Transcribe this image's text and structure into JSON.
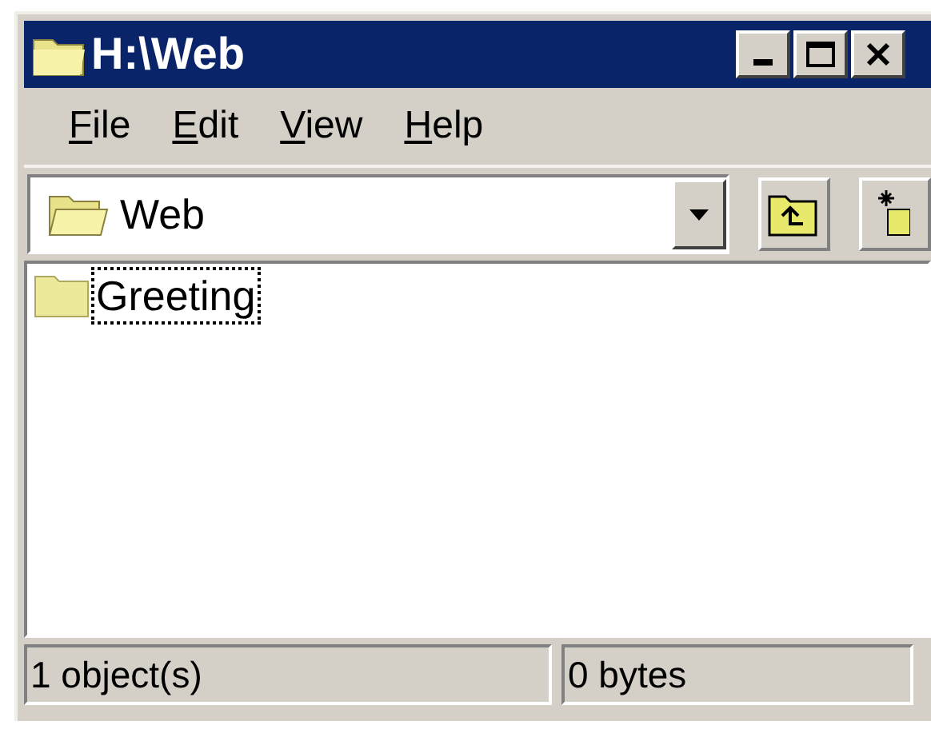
{
  "window": {
    "title": "H:\\Web"
  },
  "menu": [
    {
      "label": "File"
    },
    {
      "label": "Edit"
    },
    {
      "label": "View"
    },
    {
      "label": "Help"
    }
  ],
  "address": {
    "value": "Web"
  },
  "items": [
    {
      "label": "Greeting",
      "focused": true
    }
  ],
  "status_bar": [
    "1 object(s)",
    "0 bytes"
  ]
}
